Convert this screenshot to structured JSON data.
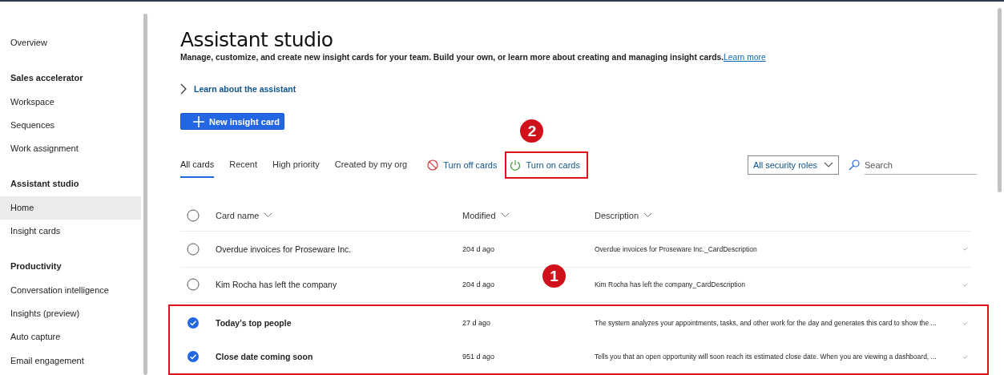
{
  "sidebar": {
    "items": [
      {
        "label": "Overview",
        "kind": "item",
        "selected": false
      },
      {
        "label": "Sales accelerator",
        "kind": "heading"
      },
      {
        "label": "Workspace",
        "kind": "item",
        "selected": false
      },
      {
        "label": "Sequences",
        "kind": "item",
        "selected": false
      },
      {
        "label": "Work assignment",
        "kind": "item",
        "selected": false
      },
      {
        "label": "Assistant studio",
        "kind": "heading"
      },
      {
        "label": "Home",
        "kind": "item",
        "selected": true
      },
      {
        "label": "Insight cards",
        "kind": "item",
        "selected": false
      },
      {
        "label": "Productivity",
        "kind": "heading"
      },
      {
        "label": "Conversation intelligence",
        "kind": "item",
        "selected": false
      },
      {
        "label": "Insights (preview)",
        "kind": "item",
        "selected": false
      },
      {
        "label": "Auto capture",
        "kind": "item",
        "selected": false
      },
      {
        "label": "Email engagement",
        "kind": "item",
        "selected": false
      }
    ]
  },
  "page": {
    "title": "Assistant studio",
    "description": "Manage, customize, and create new insight cards for your team. Build your own, or learn more about creating and managing insight cards.",
    "learn_more": "Learn more",
    "expander": "Learn about the assistant",
    "new_button": "New insight card"
  },
  "tabs": [
    {
      "label": "All cards",
      "selected": true
    },
    {
      "label": "Recent",
      "selected": false
    },
    {
      "label": "High priority",
      "selected": false
    },
    {
      "label": "Created by my org",
      "selected": false
    }
  ],
  "actions": [
    {
      "label": "Turn off cards",
      "kind": "off",
      "highlighted": false
    },
    {
      "label": "Turn on cards",
      "kind": "on",
      "highlighted": true,
      "callout": "2"
    }
  ],
  "filter": {
    "value": "All security roles"
  },
  "search": {
    "placeholder": "Search"
  },
  "table": {
    "all_selected": false,
    "columns": [
      "Card name",
      "Modified",
      "Description"
    ],
    "rows": [
      {
        "name": "Overdue invoices for Proseware Inc.",
        "modified": "204 d ago",
        "description": "Overdue invoices for Proseware Inc._CardDescription",
        "selected": false,
        "highlighted": false
      },
      {
        "name": "Kim Rocha has left the company",
        "modified": "204 d ago",
        "description": "Kim Rocha has left the company_CardDescription",
        "selected": false,
        "highlighted": false
      },
      {
        "name": "Today's top people",
        "modified": "27 d ago",
        "description": "The system analyzes your appointments, tasks, and other work for the day and generates this card to show the ...",
        "selected": true,
        "highlighted": true
      },
      {
        "name": "Close date coming soon",
        "modified": "951 d ago",
        "description": "Tells you that an open opportunity will soon reach its estimated close date. When you are viewing a dashboard, ...",
        "selected": true,
        "highlighted": true
      }
    ],
    "callout": "1"
  }
}
